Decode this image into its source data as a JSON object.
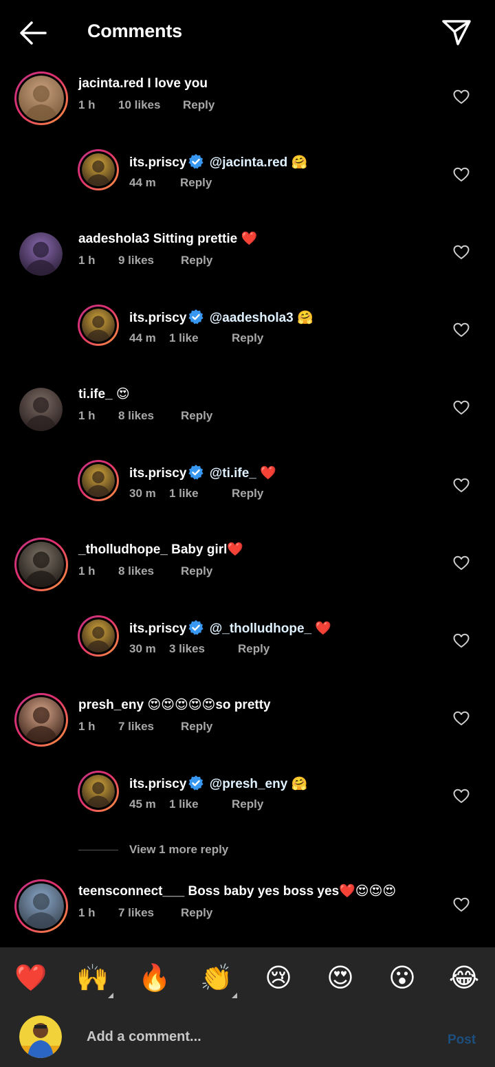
{
  "header": {
    "title": "Comments"
  },
  "comments": [
    {
      "user": "jacinta.red",
      "text": " I love you",
      "time": "1 h",
      "likes": "10 likes",
      "reply": "Reply"
    },
    {
      "user": "its.priscy",
      "mention": "@jacinta.red",
      "emoji": "🤗",
      "time": "44 m",
      "likes": "",
      "reply": "Reply"
    },
    {
      "user": "aadeshola3",
      "text": " Sitting prettie ❤️",
      "time": "1 h",
      "likes": "9 likes",
      "reply": "Reply"
    },
    {
      "user": "its.priscy",
      "mention": "@aadeshola3",
      "emoji": "🤗",
      "time": "44 m",
      "likes": "1 like",
      "reply": "Reply"
    },
    {
      "user": "ti.ife_",
      "text": " 😍",
      "time": "1 h",
      "likes": "8 likes",
      "reply": "Reply"
    },
    {
      "user": "its.priscy",
      "mention": "@ti.ife_",
      "emoji": "❤️",
      "time": "30 m",
      "likes": "1 like",
      "reply": "Reply"
    },
    {
      "user": "_tholludhope_",
      "text": " Baby girl❤️",
      "time": "1 h",
      "likes": "8 likes",
      "reply": "Reply"
    },
    {
      "user": "its.priscy",
      "mention": "@_tholludhope_",
      "emoji": "❤️",
      "time": "30 m",
      "likes": "3 likes",
      "reply": "Reply"
    },
    {
      "user": "presh_eny",
      "text": " 😍😍😍😍😍so pretty",
      "time": "1 h",
      "likes": "7 likes",
      "reply": "Reply"
    },
    {
      "user": "its.priscy",
      "mention": "@presh_eny",
      "emoji": "🤗",
      "time": "45 m",
      "likes": "1 like",
      "reply": "Reply"
    },
    {
      "user": "teensconnect___",
      "text": " Boss baby yes boss yes❤️😍😍😍",
      "time": "1 h",
      "likes": "7 likes",
      "reply": "Reply"
    }
  ],
  "view_more": "View 1 more reply",
  "emoji_bar": [
    "❤️",
    "🙌",
    "🔥",
    "👏",
    "😢",
    "😍",
    "😮",
    "😂"
  ],
  "composer": {
    "placeholder": "Add a comment...",
    "post_label": "Post"
  },
  "colors": {
    "background": "#000000",
    "bar": "#262626",
    "muted": "#a8a8a8",
    "verified": "#3897f0",
    "post_disabled": "#1c4f7e"
  }
}
